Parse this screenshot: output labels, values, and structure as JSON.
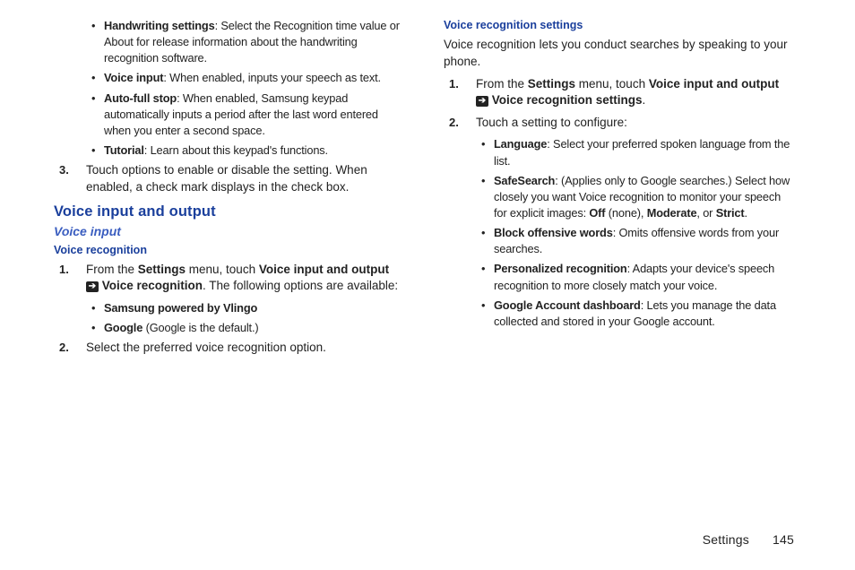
{
  "footer": {
    "section": "Settings",
    "page": "145"
  },
  "leftTop": {
    "b1_label": "Handwriting settings",
    "b1_text": ": Select the Recognition time value or About for release information about the handwriting recognition software.",
    "b2_label": "Voice input",
    "b2_text": ": When enabled, inputs your speech as text.",
    "b3_label": "Auto-full stop",
    "b3_text": ": When enabled, Samsung keypad automatically inputs a period after the last word entered when you enter a second space.",
    "b4_label": "Tutorial",
    "b4_text": ": Learn about this keypad's functions.",
    "n3_num": "3.",
    "n3_text": "Touch options to enable or disable the setting. When enabled, a check mark displays in the check box."
  },
  "vio": {
    "h1": "Voice input and output",
    "h2": "Voice input",
    "h3": "Voice recognition",
    "n1_num": "1.",
    "n1_a": "From the ",
    "n1_b": "Settings",
    "n1_c": " menu, touch ",
    "n1_d": "Voice input and output",
    "n1_e": "Voice recognition",
    "n1_f": ". The following options are available:",
    "sb1": "Samsung powered by Vlingo",
    "sb2a": "Google",
    "sb2b": " (Google is the default.)",
    "n2_num": "2.",
    "n2_text": "Select the preferred voice recognition option."
  },
  "vrs": {
    "h": "Voice recognition settings",
    "intro": "Voice recognition lets you conduct searches by speaking to your phone.",
    "n1_num": "1.",
    "n1_a": "From the ",
    "n1_b": "Settings",
    "n1_c": " menu, touch ",
    "n1_d": "Voice input and output",
    "n1_e": "Voice recognition settings",
    "n1_f": ".",
    "n2_num": "2.",
    "n2_text": "Touch a setting to configure:",
    "b1_label": "Language",
    "b1_text": ": Select your preferred spoken language from the list.",
    "b2_label": "SafeSearch",
    "b2_text_a": ": (Applies only to Google searches.) Select how closely you want Voice recognition to monitor your speech for explicit images: ",
    "b2_off": "Off",
    "b2_text_b": " (none), ",
    "b2_mod": "Moderate",
    "b2_text_c": ", or ",
    "b2_strict": "Strict",
    "b2_text_d": ".",
    "b3_label": "Block offensive words",
    "b3_text": ": Omits offensive words from your searches.",
    "b4_label": "Personalized recognition",
    "b4_text": ": Adapts your device's speech recognition to more closely match your voice.",
    "b5_label": "Google Account dashboard",
    "b5_text": ": Lets you manage the data collected and stored in your Google account."
  }
}
